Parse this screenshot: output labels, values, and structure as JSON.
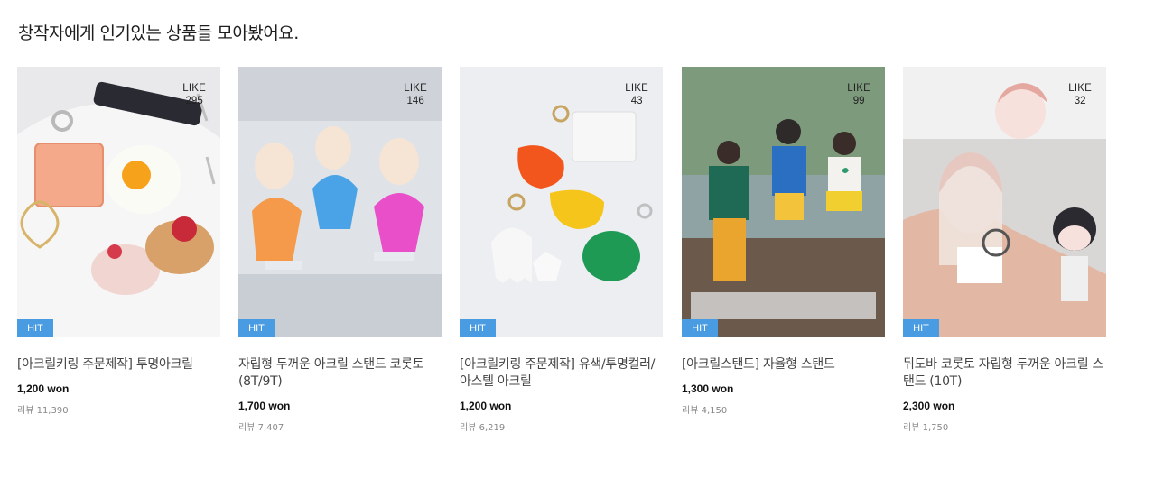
{
  "section": {
    "title": "창작자에게 인기있는 상품들 모아봤어요."
  },
  "labels": {
    "like": "LIKE",
    "hit": "HIT"
  },
  "products": [
    {
      "name": "[아크릴키링 주문제작] 투명아크릴",
      "price": "1,200 won",
      "reviews": "리뷰 11,390",
      "likes": "295"
    },
    {
      "name": "자립형 두꺼운 아크릴 스탠드 코롯토 (8T/9T)",
      "price": "1,700 won",
      "reviews": "리뷰 7,407",
      "likes": "146"
    },
    {
      "name": "[아크릴키링 주문제작] 유색/투명컬러/아스텔 아크릴",
      "price": "1,200 won",
      "reviews": "리뷰 6,219",
      "likes": "43"
    },
    {
      "name": "[아크릴스탠드] 자율형 스탠드",
      "price": "1,300 won",
      "reviews": "리뷰 4,150",
      "likes": "99"
    },
    {
      "name": "뒤도바 코롯토 자립형 두꺼운 아크릴 스탠드 (10T)",
      "price": "2,300 won",
      "reviews": "리뷰 1,750",
      "likes": "32"
    }
  ],
  "colors": {
    "hit_badge": "#4a9ce2",
    "price": "#111111",
    "review": "#888888"
  }
}
